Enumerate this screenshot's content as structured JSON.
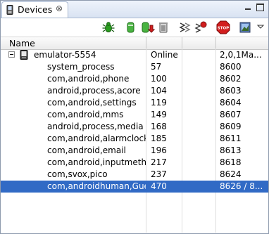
{
  "tab": {
    "title": "Devices",
    "close_glyph": "⊗"
  },
  "toolbar": {
    "icons": [
      "bug-icon",
      "heap-update-icon",
      "dump-hprof-icon",
      "gc-icon",
      "threads-update-icon",
      "thread-stop-icon",
      "stop-process-icon",
      "screen-capture-icon",
      "view-menu-icon"
    ]
  },
  "columns": {
    "name": "Name"
  },
  "device": {
    "name": "emulator-5554",
    "status": "Online",
    "version": "2,0,1Ma..."
  },
  "processes": [
    {
      "name": "system_process",
      "pid": "57",
      "port": "8600"
    },
    {
      "name": "com,android,phone",
      "pid": "100",
      "port": "8602"
    },
    {
      "name": "android,process,acore",
      "pid": "104",
      "port": "8603"
    },
    {
      "name": "com,android,settings",
      "pid": "119",
      "port": "8604"
    },
    {
      "name": "com,android,mms",
      "pid": "149",
      "port": "8607"
    },
    {
      "name": "android,process,media",
      "pid": "168",
      "port": "8609"
    },
    {
      "name": "com,android,alarmclock",
      "pid": "185",
      "port": "8611"
    },
    {
      "name": "com,android,email",
      "pid": "196",
      "port": "8613"
    },
    {
      "name": "com,android,inputmethod",
      "pid": "217",
      "port": "8618"
    },
    {
      "name": "com,svox,pico",
      "pid": "237",
      "port": "8624"
    },
    {
      "name": "com,androidhuman,Guest",
      "pid": "470",
      "port": "8626 / 8..."
    }
  ],
  "selected_index": 10,
  "colors": {
    "selection": "#316ac5",
    "bug": "#2a9d1f",
    "stop": "#d21e1e"
  }
}
